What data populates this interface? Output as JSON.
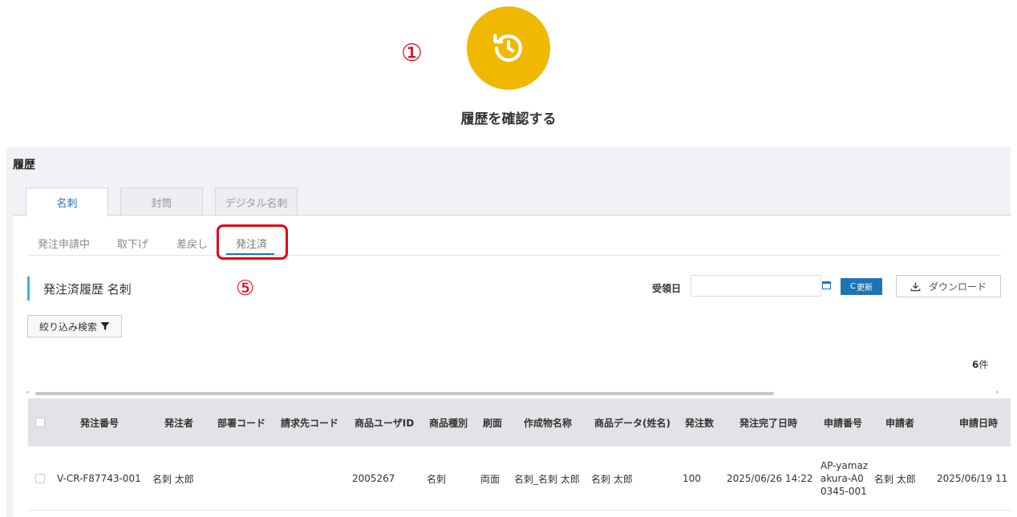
{
  "annotations": {
    "step1": "①",
    "step5": "⑤"
  },
  "hero": {
    "caption": "履歴を確認する",
    "icon": "history-icon",
    "color": "#f0b800"
  },
  "panel": {
    "title": "履歴",
    "tabs": [
      "名刺",
      "封筒",
      "デジタル名刺"
    ],
    "subtabs": [
      "発注申請中",
      "取下げ",
      "差戻し",
      "発注済"
    ]
  },
  "section": {
    "title": "発注済履歴 名刺",
    "date_label": "受領日",
    "date_value": "",
    "refresh_label": "更新",
    "download_label": "ダウンロード",
    "filter_label": "絞り込み検索",
    "count": "6",
    "count_unit": "件"
  },
  "table": {
    "columns": [
      "発注番号",
      "発注者",
      "部署コード",
      "請求先コード",
      "商品ユーザID",
      "商品種別",
      "刷面",
      "作成物名称",
      "商品データ(姓名)",
      "発注数",
      "発注完了日時",
      "申請番号",
      "申請者",
      "申請日時"
    ],
    "rows": [
      [
        "V-CR-F87743-001",
        "名刺 太郎",
        "",
        "",
        "2005267",
        "名刺",
        "両面",
        "名刺_名刺 太郎",
        "名刺 太郎",
        "100",
        "2025/06/26 14:22",
        "AP-yamazakura-A00345-001",
        "名刺 太郎",
        "2025/06/19 11"
      ]
    ]
  },
  "colors": {
    "accent": "#1d75b8",
    "highlight": "#e60012",
    "section_bar": "#3ab4d9"
  }
}
